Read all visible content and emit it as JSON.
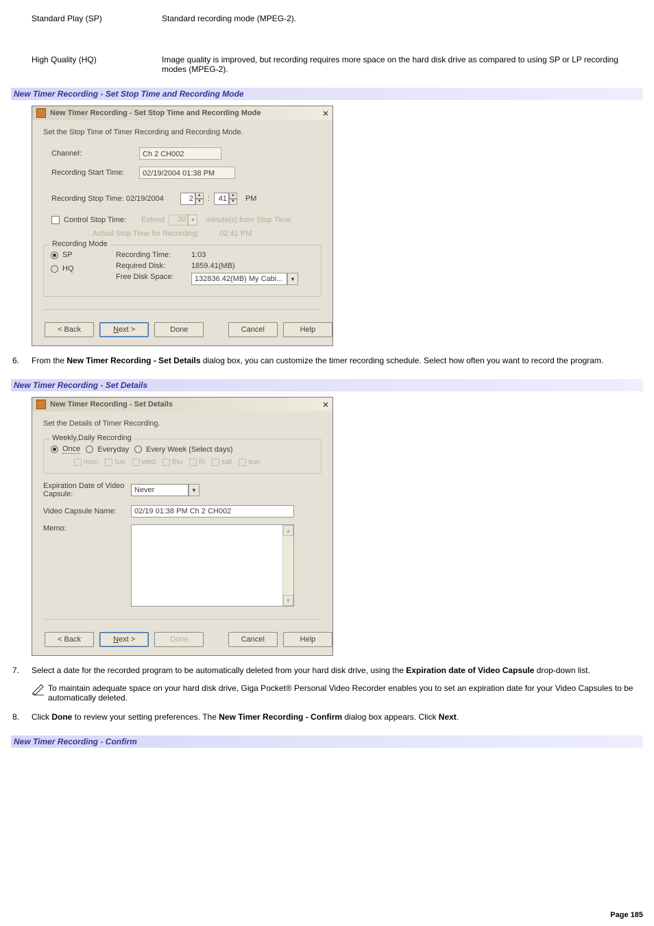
{
  "defs": {
    "sp_term": "Standard Play (SP)",
    "sp_desc": "Standard recording mode (MPEG-2).",
    "hq_term": "High Quality (HQ)",
    "hq_desc": "Image quality is improved, but recording requires more space on the hard disk drive as compared to using SP or LP recording modes (MPEG-2)."
  },
  "section1_title": "New Timer Recording - Set Stop Time and Recording Mode",
  "dialog1": {
    "title": "New Timer Recording - Set Stop Time and Recording Mode",
    "close": "×",
    "helper": "Set the Stop Time of Timer Recording and Recording Mode.",
    "channel_label": "Channel:",
    "channel_value": "Ch 2 CH002",
    "start_label": "Recording Start Time:",
    "start_value": "02/19/2004 01:38 PM",
    "stop_label": "Recording Stop Time:",
    "stop_date": "02/19/2004",
    "stop_hh": "2",
    "stop_mm": "41",
    "stop_ampm": "PM",
    "colon": ":",
    "control_label": "Control Stop Time:",
    "extend": "Extend",
    "extend_val": "30",
    "extend_tail": "minute(s) from Stop Time.",
    "actual_label": "Actual Stop Time for Recording:",
    "actual_value": "02:41 PM",
    "group_title": "Recording Mode",
    "radio_sp": "SP",
    "radio_hq": "HQ",
    "kv_rec_time_k": "Recording Time:",
    "kv_rec_time_v": "1:03",
    "kv_req_disk_k": "Required Disk:",
    "kv_req_disk_v": "1859.41(MB)",
    "kv_free_k": "Free Disk Space:",
    "kv_free_v": "132836.42(MB) My Cabi...",
    "btn_back": "< Back",
    "btn_next": "Next >",
    "btn_done": "Done",
    "btn_cancel": "Cancel",
    "btn_help": "Help"
  },
  "step6": {
    "num": "6.",
    "before_bold": "From the ",
    "bold": "New Timer Recording - Set Details",
    "after_bold": " dialog box, you can customize the timer recording schedule. Select how often you want to record the program."
  },
  "section2_title": "New Timer Recording - Set Details",
  "dialog2": {
    "title": "New Timer Recording - Set Details",
    "close": "×",
    "helper": "Set the Details of Timer Recording.",
    "group_title": "Weekly,Daily Recording",
    "opt_once": "Once",
    "opt_every": "Everyday",
    "opt_week": "Every Week (Select days)",
    "days": {
      "mon": "mon",
      "tue": "tue",
      "wed": "wed",
      "thu": "thu",
      "fri": "fri",
      "sat": "sat",
      "sun": "sun"
    },
    "exp_label": "Expiration Date of Video Capsule:",
    "exp_value": "Never",
    "cap_label": "Video Capsule Name:",
    "cap_value": "02/19 01:38 PM Ch 2 CH002",
    "memo_label": "Memo:",
    "btn_back": "< Back",
    "btn_next": "Next >",
    "btn_done": "Done",
    "btn_cancel": "Cancel",
    "btn_help": "Help"
  },
  "step7": {
    "num": "7.",
    "p1_before": "Select a date for the recorded program to be automatically deleted from your hard disk drive, using the ",
    "p1_bold": "Expiration date of Video Capsule",
    "p1_after": " drop-down list.",
    "note": " To maintain adequate space on your hard disk drive, Giga Pocket® Personal Video Recorder enables you to set an expiration date for your Video Capsules to be automatically deleted."
  },
  "step8": {
    "num": "8.",
    "s1": "Click ",
    "b1": "Done",
    "s2": " to review your setting preferences. The ",
    "b2": "New Timer Recording - Confirm",
    "s3": " dialog box appears. Click ",
    "b3": "Next",
    "s4": "."
  },
  "section3_title": "New Timer Recording - Confirm",
  "page_number": "Page 185"
}
